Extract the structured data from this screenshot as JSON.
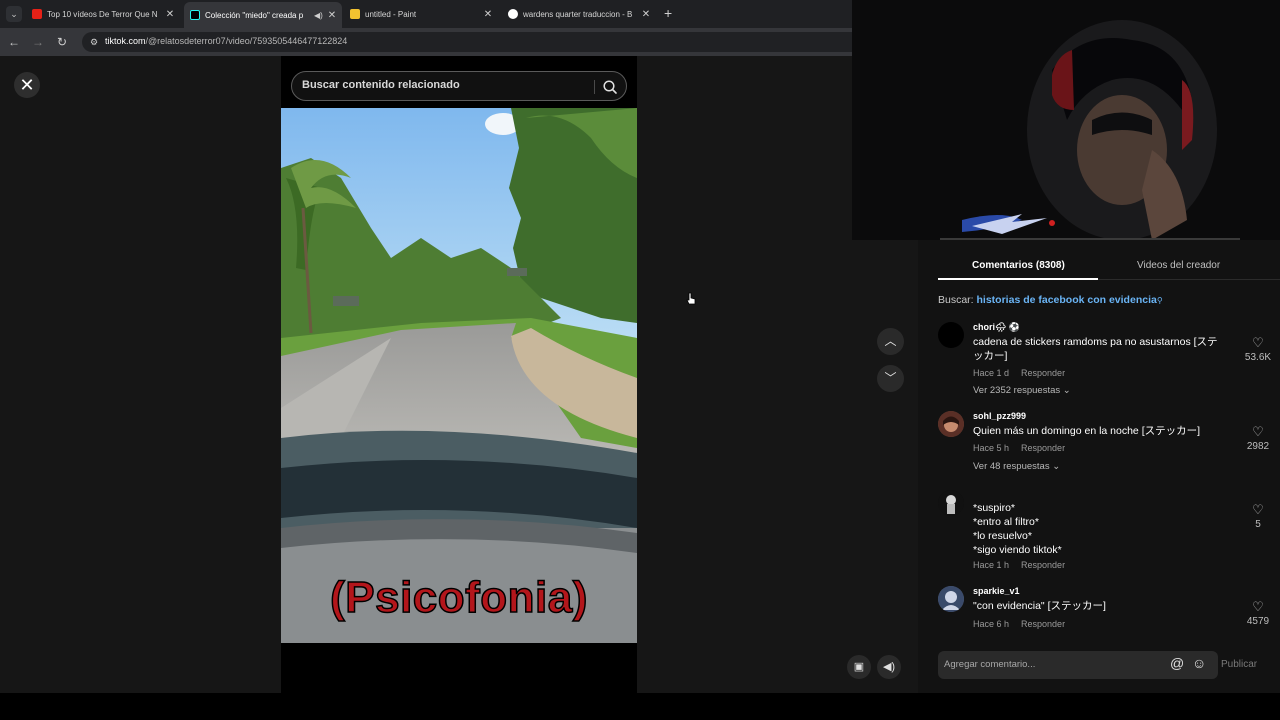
{
  "browser": {
    "tabs": [
      {
        "title": "Top 10 vídeos De Terror Que N",
        "icon": "youtube-icon",
        "active": false
      },
      {
        "title": "Colección \"miedo\" creada p",
        "icon": "tiktok-icon",
        "active": true
      },
      {
        "title": "untitled - Paint",
        "icon": "paint-icon",
        "active": false
      },
      {
        "title": "wardens quarter traduccion - B",
        "icon": "google-icon",
        "active": false
      }
    ],
    "url_host": "tiktok.com",
    "url_path": "/@relatosdeterror07/video/7593505446477122824"
  },
  "search": {
    "placeholder": "Buscar contenido relacionado"
  },
  "video": {
    "caption": "(Psicofonia)"
  },
  "panel": {
    "tab_comments": "Comentarios (8308)",
    "tab_creator": "Videos del creador",
    "related_prefix": "Buscar: ",
    "related_term": "historias de facebook con evidencia"
  },
  "comments": [
    {
      "user": "chori🌧 ⚽",
      "text": "cadena de stickers ramdoms pa no asustarnos [ステッカー]",
      "time": "Hace 1 d",
      "reply": "Responder",
      "replies": "Ver 2352 respuestas ⌄",
      "likes": "53.6K"
    },
    {
      "user": "sohl_pzz999",
      "text": "Quien más un domingo en la noche [ステッカー]",
      "time": "Hace 5 h",
      "reply": "Responder",
      "replies": "Ver 48 respuestas ⌄",
      "likes": "2982"
    },
    {
      "user": "",
      "text_lines": [
        "*suspiro*",
        "*entro al filtro*",
        "*lo resuelvo*",
        "*sigo viendo tiktok*"
      ],
      "time": "Hace 1 h",
      "reply": "Responder",
      "likes": "5"
    },
    {
      "user": "sparkie_v1",
      "text": "\"con evidencia\" [ステッカー]",
      "time": "Hace 6 h",
      "reply": "Responder",
      "likes": "4579"
    }
  ],
  "composer": {
    "placeholder": "Agregar comentario...",
    "post": "Publicar"
  },
  "colors": {
    "link": "#6ab4f5",
    "caption": "#b3161b",
    "panel_bg": "#121212",
    "stage_bg": "#161616"
  }
}
